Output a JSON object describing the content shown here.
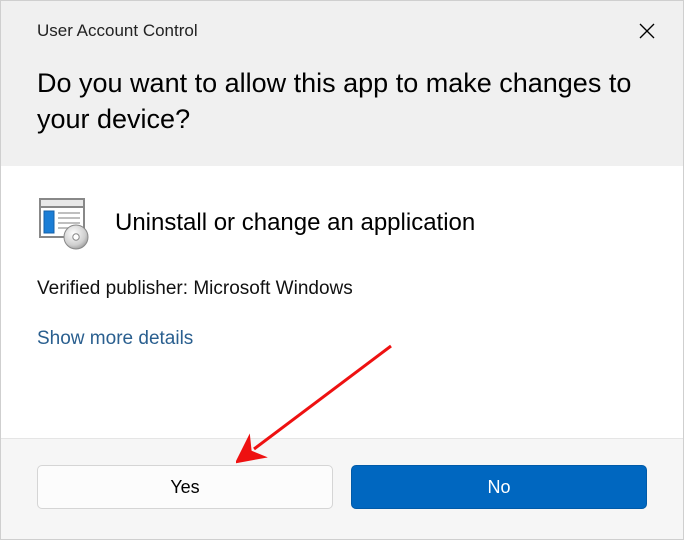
{
  "header": {
    "title": "User Account Control",
    "question": "Do you want to allow this app to make changes to your device?"
  },
  "body": {
    "app_name": "Uninstall or change an application",
    "publisher_label": "Verified publisher: Microsoft Windows",
    "show_more": "Show more details"
  },
  "footer": {
    "yes": "Yes",
    "no": "No"
  }
}
